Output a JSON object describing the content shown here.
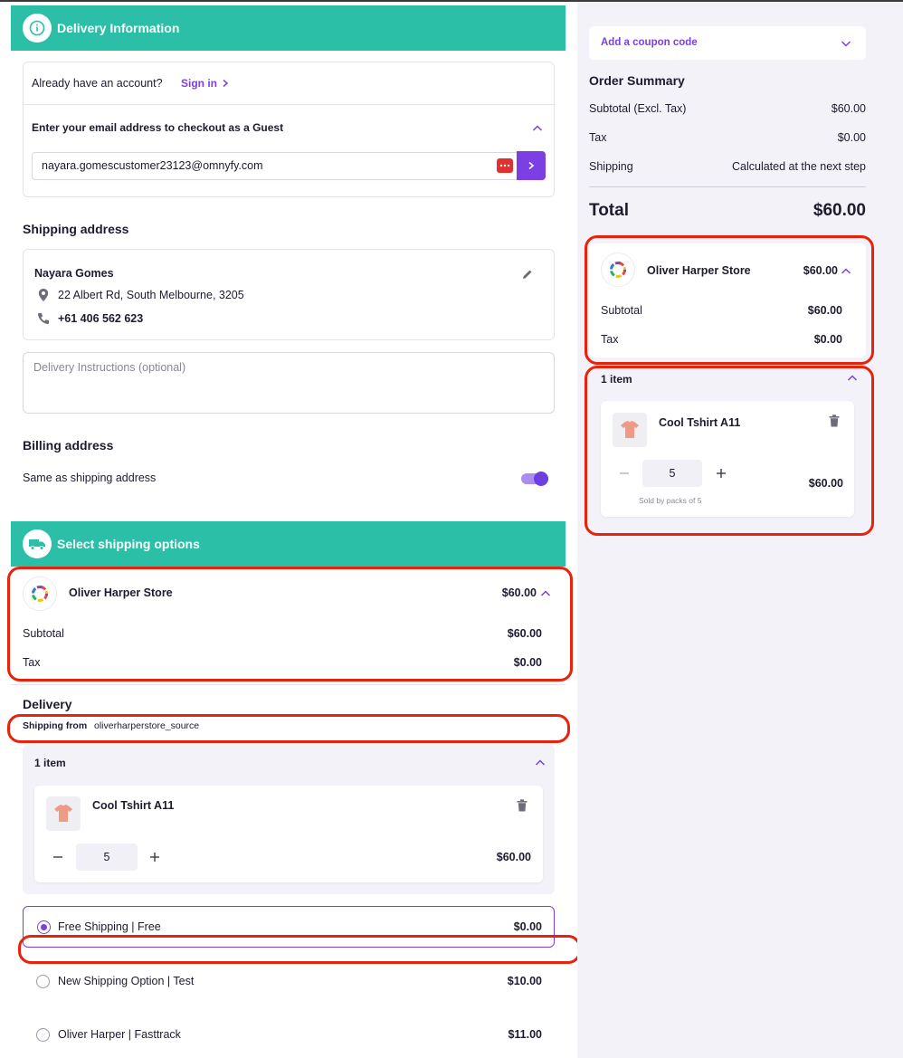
{
  "delivery_info": {
    "title": "Delivery Information",
    "have_account": "Already have an account?",
    "sign_in": "Sign in",
    "guest_prompt": "Enter your email address to checkout as a Guest",
    "email_value": "nayara.gomescustomer23123@omnyfy.com"
  },
  "shipping_address": {
    "heading": "Shipping address",
    "name": "Nayara Gomes",
    "address": "22 Albert Rd, South Melbourne, 3205",
    "phone": "+61 406 562 623",
    "instructions_placeholder": "Delivery Instructions (optional)"
  },
  "billing": {
    "heading": "Billing address",
    "same_label": "Same as shipping address",
    "same_enabled": true
  },
  "shipping_options": {
    "title": "Select shipping options",
    "store_name": "Oliver Harper Store",
    "store_total": "$60.00",
    "subtotal_label": "Subtotal",
    "subtotal_value": "$60.00",
    "tax_label": "Tax",
    "tax_value": "$0.00",
    "delivery_heading": "Delivery",
    "shipping_from_label": "Shipping from",
    "shipping_from_value": "oliverharperstore_source",
    "items_label": "1 item",
    "item_name": "Cool Tshirt A11",
    "item_qty": "5",
    "item_price": "$60.00",
    "options": [
      {
        "label": "Free Shipping | Free",
        "price": "$0.00",
        "selected": true
      },
      {
        "label": "New Shipping Option | Test",
        "price": "$10.00",
        "selected": false
      },
      {
        "label": "Oliver Harper | Fasttrack",
        "price": "$11.00",
        "selected": false
      }
    ]
  },
  "summary": {
    "coupon": "Add a coupon code",
    "heading": "Order Summary",
    "subtotal_label": "Subtotal (Excl. Tax)",
    "subtotal_value": "$60.00",
    "tax_label": "Tax",
    "tax_value": "$0.00",
    "shipping_label": "Shipping",
    "shipping_value": "Calculated at the next step",
    "total_label": "Total",
    "total_value": "$60.00",
    "store_name": "Oliver Harper Store",
    "store_total": "$60.00",
    "store_subtotal_label": "Subtotal",
    "store_subtotal_value": "$60.00",
    "store_tax_label": "Tax",
    "store_tax_value": "$0.00",
    "items_label": "1 item",
    "item_name": "Cool Tshirt A11",
    "item_qty": "5",
    "item_note": "Sold by packs of 5",
    "item_price": "$60.00"
  },
  "colors": {
    "accent": "#7b3fe4",
    "banner": "#2bbfa8",
    "highlight": "#e8220b"
  }
}
